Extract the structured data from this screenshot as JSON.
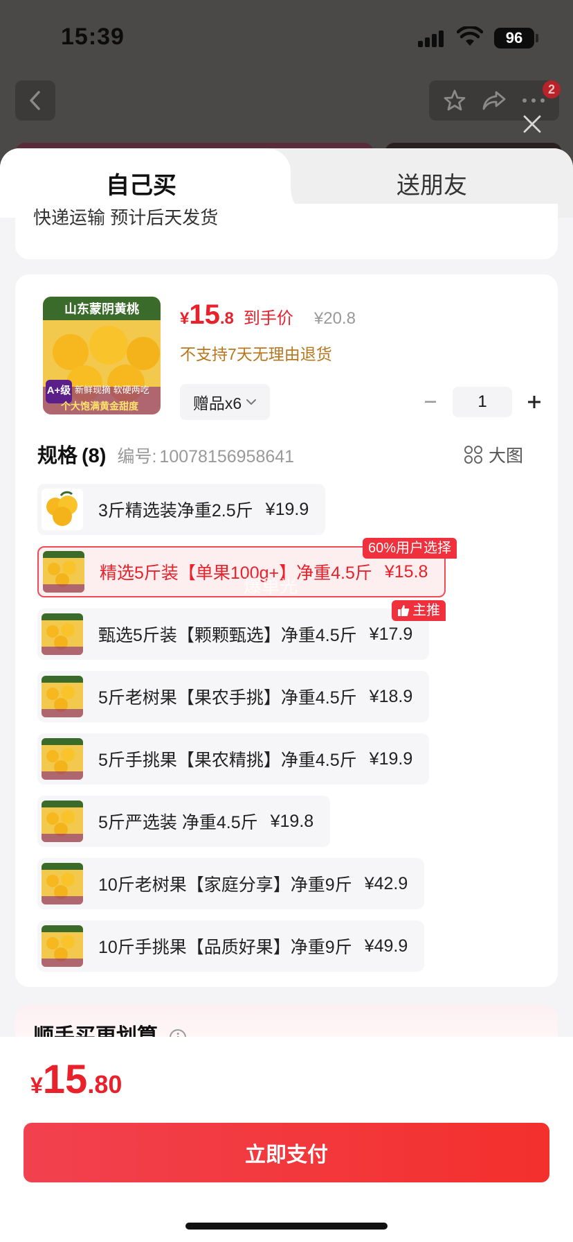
{
  "status_bar": {
    "time": "15:39",
    "battery": "96"
  },
  "nav": {
    "badge_count": "2",
    "icons": [
      "back-arrow-icon",
      "star-icon",
      "share-icon",
      "more-icon",
      "close-icon"
    ]
  },
  "tabs": {
    "self_buy": "自己买",
    "gift": "送朋友"
  },
  "shipping": {
    "text": "快递运输 预计后天发货"
  },
  "product": {
    "price_symbol": "¥",
    "price_int": "15",
    "price_dec": ".8",
    "price_label": "到手价",
    "original_price": "¥20.8",
    "return_policy": "不支持7天无理由退货",
    "gift_label": "赠品x6",
    "quantity": "1",
    "image_title": "山东蒙阴黄桃",
    "image_badge": "A+级",
    "image_tag1": "新鲜现摘 软硬两吃",
    "image_tag2": "个大饱满黄金甜度"
  },
  "specs": {
    "title": "规格",
    "count": "(8)",
    "code_label": "编号:",
    "code": "10078156958641",
    "big_view_label": "大图",
    "options": [
      {
        "label": "3斤精选装净重2.5斤",
        "price": "¥19.9"
      },
      {
        "label": "精选5斤装【单果100g+】净重4.5斤",
        "price": "¥15.8",
        "badge": "60%用户选择",
        "selected": true
      },
      {
        "label": "甄选5斤装【颗颗甄选】净重4.5斤",
        "price": "¥17.9",
        "badge": "主推"
      },
      {
        "label": "5斤老树果【果农手挑】净重4.5斤",
        "price": "¥18.9"
      },
      {
        "label": "5斤手挑果【果农精挑】净重4.5斤",
        "price": "¥19.9"
      },
      {
        "label": "5斤严选装 净重4.5斤",
        "price": "¥19.8"
      },
      {
        "label": "10斤老树果【家庭分享】净重9斤",
        "price": "¥42.9"
      },
      {
        "label": "10斤手挑果【品质好果】净重9斤",
        "price": "¥49.9"
      }
    ],
    "watermark": "爆单光"
  },
  "promo": {
    "title": "顺手买更划算"
  },
  "footer": {
    "total_symbol": "¥",
    "total_int": "15",
    "total_dec": ".80",
    "pay_label": "立即支付"
  },
  "colors": {
    "accent": "#e8212a",
    "selected_bg": "#fdeff0",
    "warning": "#b8771e"
  }
}
